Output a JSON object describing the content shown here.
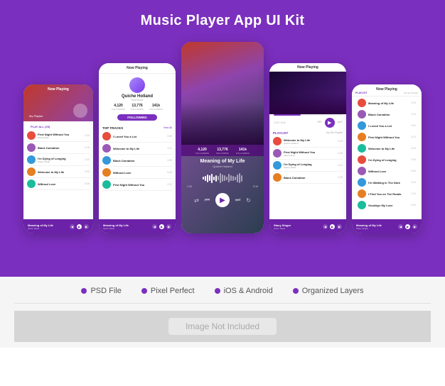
{
  "page": {
    "title": "Music Player App UI Kit"
  },
  "features": [
    {
      "label": "PSD File",
      "color": "#7B2FBE"
    },
    {
      "label": "Pixel Perfect",
      "color": "#7B2FBE"
    },
    {
      "label": "iOS & Android",
      "color": "#7B2FBE"
    },
    {
      "label": "Organized Layers",
      "color": "#7B2FBE"
    }
  ],
  "bottom_note": "Image Not Included",
  "phones": {
    "phone1": {
      "header_label": "Now Playing",
      "playlist_label": "My Playlist",
      "play_all": "PLAY ALL (25)",
      "songs": [
        {
          "name": "First Night Without You",
          "artist": "Olivia Haris",
          "dur": "3:24",
          "color": "#e74c3c"
        },
        {
          "name": "Black Carnation",
          "artist": "",
          "dur": "3:16",
          "color": "#9b59b6"
        },
        {
          "name": "I'm Dying of Longing",
          "artist": "Shane Vlado",
          "dur": "4:22",
          "color": "#3498db"
        },
        {
          "name": "Welcome to My Life",
          "artist": "Quiche Holland",
          "dur": "3:33",
          "color": "#e67e22"
        },
        {
          "name": "Without Love",
          "artist": "Melissa Broderick",
          "dur": "5:06",
          "color": "#1abc9c"
        }
      ],
      "current_song": "Meaning of My Life",
      "current_artist": "Quinn Reed"
    },
    "phone2": {
      "header_label": "Now Playing",
      "artist_name": "Quiche Holland",
      "artist_subtitle": "Soul Music",
      "stats": [
        {
          "val": "4,120",
          "label": "FOLLOWERS"
        },
        {
          "val": "13,776",
          "label": "FOLLOWING"
        },
        {
          "val": "141k",
          "label": "FOLLOWERS"
        }
      ],
      "follow_btn": "FOLLOWING",
      "top_tracks_label": "TOP TRACKS",
      "see_all": "View All",
      "tracks": [
        {
          "name": "I Loved You a Lot",
          "dur": "3:05",
          "color": "#e74c3c"
        },
        {
          "name": "Welcome to My Life",
          "dur": "4:11",
          "color": "#9b59b6"
        },
        {
          "name": "Black Carnation",
          "dur": "3:25",
          "color": "#3498db"
        },
        {
          "name": "Without Love",
          "dur": "5:06",
          "color": "#e67e22"
        },
        {
          "name": "First Night Without You",
          "dur": "3:12",
          "color": "#1abc9c"
        }
      ],
      "current_song": "Meaning of My Life",
      "current_artist": "Quinn Reed"
    },
    "phone3": {
      "stats": [
        {
          "val": "4,120",
          "label": "FOLLOWERS"
        },
        {
          "val": "13,776",
          "label": "FOLLOWING"
        },
        {
          "val": "141k",
          "label": "FOLLOWERS"
        }
      ],
      "song_title": "Meaning of My Life",
      "artist": "Quiche Holland",
      "time_current": "1:33",
      "time_total": "5:16",
      "waveform_bars": [
        3,
        5,
        8,
        6,
        10,
        12,
        8,
        6,
        14,
        10,
        8,
        6,
        12,
        9,
        7,
        5,
        11,
        14,
        10,
        8,
        6,
        4,
        9,
        12,
        8,
        5,
        7,
        10,
        8,
        6
      ]
    },
    "phone4": {
      "header_label": "Now Playing",
      "playlist_label": "PLAYLIST",
      "playlist_name": "My Mix Playlist",
      "songs": [
        {
          "name": "Welcome to My Life",
          "artist": "Quiche Holland",
          "dur": "3:24",
          "color": "#e74c3c"
        },
        {
          "name": "First Night Without You",
          "artist": "Ollie France",
          "dur": "3:16",
          "color": "#9b59b6"
        },
        {
          "name": "I'm Dying of Longing",
          "artist": "Shane Vlado",
          "dur": "4:22",
          "color": "#3498db"
        },
        {
          "name": "Black Carnation",
          "artist": "",
          "dur": "3:33",
          "color": "#e67e22"
        }
      ],
      "current_song": "Stacy Singer",
      "current_artist": "Quinn Reed"
    },
    "phone5": {
      "header_label": "Now Playing",
      "playlist_label": "PLAYLIST",
      "playlist_name": "My Mix Playlist",
      "songs": [
        {
          "name": "Meaning of My Life",
          "artist": "",
          "dur": "2:24",
          "color": "#e74c3c"
        },
        {
          "name": "Black Carnation",
          "artist": "",
          "dur": "3:16",
          "color": "#9b59b6"
        },
        {
          "name": "I Loved You a Lot",
          "artist": "",
          "dur": "4:51",
          "color": "#3498db"
        },
        {
          "name": "First Night Without You",
          "artist": "",
          "dur": "3:24",
          "color": "#e67e22"
        },
        {
          "name": "Welcome to My Life",
          "artist": "",
          "dur": "5:23",
          "color": "#1abc9c"
        },
        {
          "name": "I'm Dying of Longing",
          "artist": "",
          "dur": "4:09",
          "color": "#e74c3c"
        },
        {
          "name": "Without Love",
          "artist": "",
          "dur": "5:06",
          "color": "#9b59b6"
        },
        {
          "name": "I'm Walking in The Dark",
          "artist": "",
          "dur": "3:44",
          "color": "#3498db"
        },
        {
          "name": "I Find You on The Roads",
          "artist": "",
          "dur": "4:12",
          "color": "#e67e22"
        },
        {
          "name": "Goodbye My Love",
          "artist": "",
          "dur": "3:30",
          "color": "#1abc9c"
        }
      ],
      "current_song": "Meaning of My Life",
      "current_artist": "Stacy Singer"
    }
  }
}
